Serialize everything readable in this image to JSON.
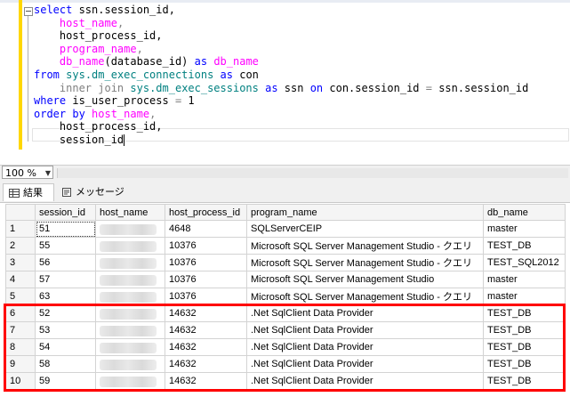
{
  "editor": {
    "lines": [
      [
        {
          "t": "select",
          "c": "kw"
        },
        {
          "t": " ssn.session_id,",
          "c": ""
        }
      ],
      [
        {
          "t": "    ",
          "c": ""
        },
        {
          "t": "host_name",
          "c": "fn"
        },
        {
          "t": ",",
          "c": "gr"
        }
      ],
      [
        {
          "t": "    host_process_id,",
          "c": ""
        }
      ],
      [
        {
          "t": "    ",
          "c": ""
        },
        {
          "t": "program_name",
          "c": "fn"
        },
        {
          "t": ",",
          "c": "gr"
        }
      ],
      [
        {
          "t": "    ",
          "c": ""
        },
        {
          "t": "db_name",
          "c": "fn"
        },
        {
          "t": "(database_id) ",
          "c": ""
        },
        {
          "t": "as",
          "c": "kw"
        },
        {
          "t": " ",
          "c": ""
        },
        {
          "t": "db_name",
          "c": "fn"
        }
      ],
      [
        {
          "t": "from",
          "c": "kw"
        },
        {
          "t": " ",
          "c": ""
        },
        {
          "t": "sys.dm_exec_connections",
          "c": "sys"
        },
        {
          "t": " ",
          "c": ""
        },
        {
          "t": "as",
          "c": "kw"
        },
        {
          "t": " con",
          "c": ""
        }
      ],
      [
        {
          "t": "    ",
          "c": ""
        },
        {
          "t": "inner join",
          "c": "gr"
        },
        {
          "t": " ",
          "c": ""
        },
        {
          "t": "sys.dm_exec_sessions",
          "c": "sys"
        },
        {
          "t": " ",
          "c": ""
        },
        {
          "t": "as",
          "c": "kw"
        },
        {
          "t": " ssn ",
          "c": ""
        },
        {
          "t": "on",
          "c": "kw"
        },
        {
          "t": " con.session_id ",
          "c": ""
        },
        {
          "t": "=",
          "c": "gr"
        },
        {
          "t": " ssn.session_id",
          "c": ""
        }
      ],
      [
        {
          "t": "where",
          "c": "kw"
        },
        {
          "t": " is_user_process ",
          "c": ""
        },
        {
          "t": "=",
          "c": "gr"
        },
        {
          "t": " 1",
          "c": ""
        }
      ],
      [
        {
          "t": "order by",
          "c": "kw"
        },
        {
          "t": " ",
          "c": ""
        },
        {
          "t": "host_name",
          "c": "fn"
        },
        {
          "t": ",",
          "c": "gr"
        }
      ],
      [
        {
          "t": "    host_process_id,",
          "c": ""
        }
      ],
      [
        {
          "t": "    session_id",
          "c": ""
        }
      ]
    ]
  },
  "zoom": {
    "value": "100 %"
  },
  "tabs": {
    "results": "結果",
    "messages": "メッセージ"
  },
  "grid": {
    "columns": [
      "session_id",
      "host_name",
      "host_process_id",
      "program_name",
      "db_name"
    ],
    "rows": [
      [
        "1",
        "51",
        "",
        "4648",
        "SQLServerCEIP",
        "master"
      ],
      [
        "2",
        "55",
        "",
        "10376",
        "Microsoft SQL Server Management Studio - クエリ",
        "TEST_DB"
      ],
      [
        "3",
        "56",
        "",
        "10376",
        "Microsoft SQL Server Management Studio - クエリ",
        "TEST_SQL2012"
      ],
      [
        "4",
        "57",
        "",
        "10376",
        "Microsoft SQL Server Management Studio",
        "master"
      ],
      [
        "5",
        "63",
        "",
        "10376",
        "Microsoft SQL Server Management Studio - クエリ",
        "master"
      ],
      [
        "6",
        "52",
        "",
        "14632",
        ".Net SqlClient Data Provider",
        "TEST_DB"
      ],
      [
        "7",
        "53",
        "",
        "14632",
        ".Net SqlClient Data Provider",
        "TEST_DB"
      ],
      [
        "8",
        "54",
        "",
        "14632",
        ".Net SqlClient Data Provider",
        "TEST_DB"
      ],
      [
        "9",
        "58",
        "",
        "14632",
        ".Net SqlClient Data Provider",
        "TEST_DB"
      ],
      [
        "10",
        "59",
        "",
        "14632",
        ".Net SqlClient Data Provider",
        "TEST_DB"
      ]
    ]
  },
  "colors": {
    "highlight": "#ff0000",
    "keyword": "#0000ff",
    "function": "#ff00ff",
    "system": "#008080"
  }
}
